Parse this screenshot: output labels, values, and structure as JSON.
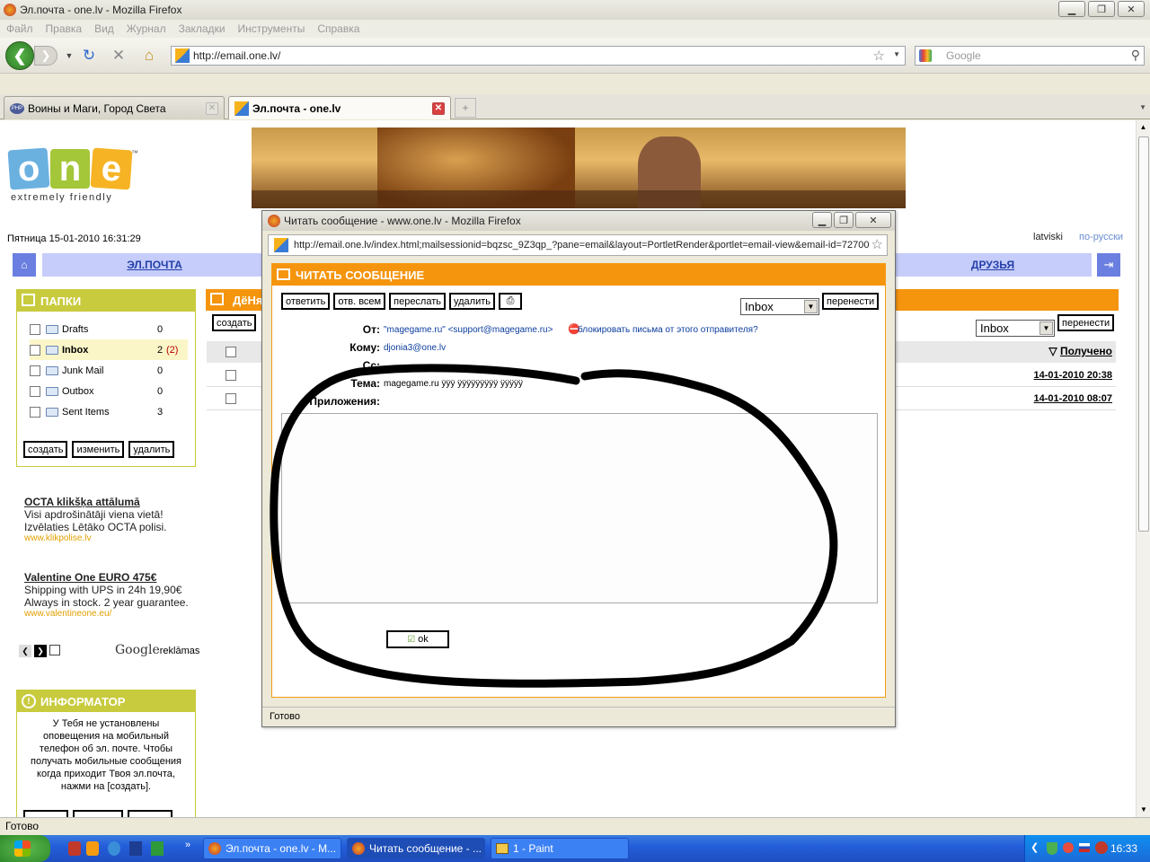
{
  "window": {
    "title": "Эл.почта - one.lv - Mozilla Firefox"
  },
  "menu": [
    "Файл",
    "Правка",
    "Вид",
    "Журнал",
    "Закладки",
    "Инструменты",
    "Справка"
  ],
  "nav": {
    "url": "http://email.one.lv/",
    "search_placeholder": "Google"
  },
  "tabs": [
    {
      "label": "Воины и Маги, Город Света"
    },
    {
      "label": "Эл.почта - one.lv"
    }
  ],
  "page": {
    "logo_text": "one",
    "logo_tagline": "extremely friendly",
    "datetime": "Пятница 15-01-2010 16:31:29",
    "lang_lv": "latviski",
    "lang_ru": "по-русски",
    "nav_email": "ЭЛ.ПОЧТА",
    "nav_friends": "ДРУЗЬЯ",
    "folders_title": "ПАПКИ",
    "folders": [
      {
        "name": "Drafts",
        "count": "0"
      },
      {
        "name": "Inbox",
        "count": "2",
        "unread": "(2)"
      },
      {
        "name": "Junk Mail",
        "count": "0"
      },
      {
        "name": "Outbox",
        "count": "0"
      },
      {
        "name": "Sent Items",
        "count": "3"
      }
    ],
    "folder_buttons": {
      "create": "создать",
      "edit": "изменить",
      "delete": "удалить"
    },
    "ads": [
      {
        "title": "OCTA klikšķa attālumā",
        "text": "Visi apdrošinātāji viena vietā! Izvēlaties Lētāko OCTA polisi.",
        "url": "www.klikpolise.lv"
      },
      {
        "title": "Valentine One EURO 475€",
        "text": "Shipping with UPS in 24h 19,90€ Always in stock. 2 year guarantee.",
        "url": "www.valentineone.eu/"
      }
    ],
    "google_ads": "Google",
    "google_ads_suffix": "reklāmas",
    "informer_title": "ИНФОРМАТОР",
    "informer_text": "У Тебя не установлены оповещения на мобильный телефон об эл. почте. Чтобы получать мобильные сообщения когда приходит Твоя эл.почта, нажми на [создать].",
    "mail_section_title": "ДёНя",
    "mail_create": "создать",
    "mail_folder_select": "Inbox",
    "mail_move": "перенести",
    "received_header": "Получено",
    "mail_dates": [
      "14-01-2010 20:38",
      "14-01-2010 08:07"
    ]
  },
  "popup": {
    "title": "Читать сообщение - www.one.lv - Mozilla Firefox",
    "url": "http://email.one.lv/index.html;mailsessionid=bqzsc_9Z3qp_?pane=email&layout=PortletRender&portlet=email-view&email-id=72700",
    "header": "ЧИТАТЬ СООБЩЕНИЕ",
    "buttons": {
      "reply": "ответить",
      "reply_all": "отв. всем",
      "forward": "переслать",
      "delete": "удалить",
      "move": "перенести"
    },
    "folder_select": "Inbox",
    "from_label": "От:",
    "from_value": "\"magegame.ru\" <support@magegame.ru>",
    "block_link": "блокировать письма от этого отправителя?",
    "to_label": "Кому:",
    "to_value": "djonia3@one.lv",
    "cc_label": "Cc:",
    "subject_label": "Тема:",
    "subject_value": "magegame.ru ÿÿÿ ÿÿÿÿÿÿÿÿÿ ÿÿÿÿÿ",
    "attachments_label": "Приложения:",
    "ok": "ok",
    "status": "Готово"
  },
  "statusbar": "Готово",
  "taskbar": {
    "items": [
      "Эл.почта - one.lv - М...",
      "Читать сообщение - ...",
      "1 - Paint"
    ],
    "clock": "16:33"
  }
}
